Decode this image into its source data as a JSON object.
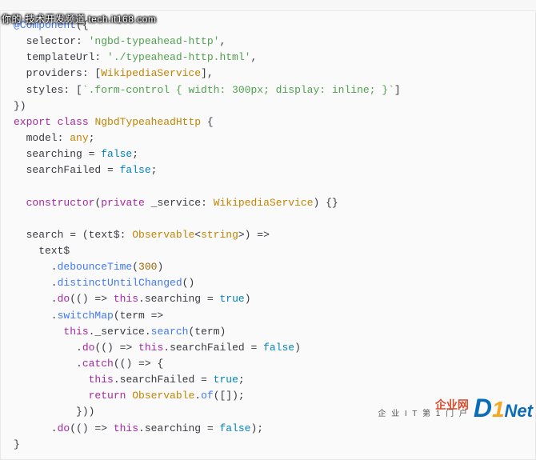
{
  "watermark": {
    "top": "你的·技术开发频道 tech.it168.com",
    "bottom_left_top": "企业网",
    "bottom_left_bottom": "企 业 I T 第 1 门 户",
    "d": "D",
    "one": "1",
    "net": "Net"
  },
  "code": {
    "l1a": "@Component",
    "l1b": "({",
    "l2a": "  selector: ",
    "l2b": "'ngbd-typeahead-http'",
    "l2c": ",",
    "l3a": "  templateUrl: ",
    "l3b": "'./typeahead-http.html'",
    "l3c": ",",
    "l4a": "  providers: [",
    "l4b": "WikipediaService",
    "l4c": "],",
    "l5a": "  styles: [",
    "l5b": "`.form-control { width: 300px; display: inline; }`",
    "l5c": "]",
    "l6": "})",
    "l7a": "export",
    "l7b": " ",
    "l7c": "class",
    "l7d": " ",
    "l7e": "NgbdTypeaheadHttp",
    "l7f": " {",
    "l8a": "  model: ",
    "l8b": "any",
    "l8c": ";",
    "l9a": "  searching = ",
    "l9b": "false",
    "l9c": ";",
    "l10a": "  searchFailed = ",
    "l10b": "false",
    "l10c": ";",
    "blank1": " ",
    "l11a": "  ",
    "l11b": "constructor",
    "l11c": "(",
    "l11d": "private",
    "l11e": " _service: ",
    "l11f": "WikipediaService",
    "l11g": ") {}",
    "blank2": " ",
    "l12a": "  search = (text$: ",
    "l12b": "Observable",
    "l12c": "<",
    "l12d": "string",
    "l12e": ">) =>",
    "l13": "    text$",
    "l14a": "      .",
    "l14b": "debounceTime",
    "l14c": "(",
    "l14d": "300",
    "l14e": ")",
    "l15a": "      .",
    "l15b": "distinctUntilChanged",
    "l15c": "()",
    "l16a": "      .",
    "l16b": "do",
    "l16c": "(() => ",
    "l16d": "this",
    "l16e": ".searching = ",
    "l16f": "true",
    "l16g": ")",
    "l17a": "      .",
    "l17b": "switchMap",
    "l17c": "(term =>",
    "l18a": "        ",
    "l18b": "this",
    "l18c": "._service.",
    "l18d": "search",
    "l18e": "(term)",
    "l19a": "          .",
    "l19b": "do",
    "l19c": "(() => ",
    "l19d": "this",
    "l19e": ".searchFailed = ",
    "l19f": "false",
    "l19g": ")",
    "l20a": "          .",
    "l20b": "catch",
    "l20c": "(() => {",
    "l21a": "            ",
    "l21b": "this",
    "l21c": ".searchFailed = ",
    "l21d": "true",
    "l21e": ";",
    "l22a": "            ",
    "l22b": "return",
    "l22c": " ",
    "l22d": "Observable",
    "l22e": ".",
    "l22f": "of",
    "l22g": "([]);",
    "l23": "          }))",
    "l24a": "      .",
    "l24b": "do",
    "l24c": "(() => ",
    "l24d": "this",
    "l24e": ".searching = ",
    "l24f": "false",
    "l24g": ");",
    "l25": "}"
  }
}
